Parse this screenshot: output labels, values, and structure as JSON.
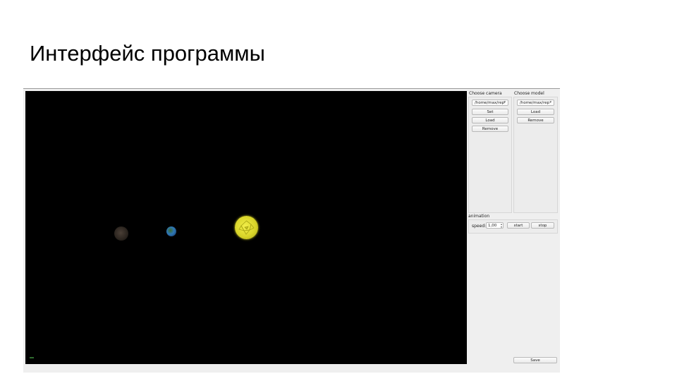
{
  "slide": {
    "title": "Интерфейс программы"
  },
  "panel": {
    "camera": {
      "title": "Choose camera",
      "selected": "/home/max/rep",
      "set_label": "Set",
      "load_label": "Load",
      "remove_label": "Remove"
    },
    "model": {
      "title": "Choose model",
      "selected": "/home/max/rep",
      "load_label": "Load",
      "remove_label": "Remove"
    },
    "animation": {
      "title": "animation",
      "speed_label": "speed:",
      "speed_value": "1,00",
      "start_label": "start",
      "stop_label": "stop"
    },
    "save_label": "Save"
  },
  "scene": {
    "background_color": "#000000",
    "objects": [
      "dark-planet",
      "earth-planet",
      "sun"
    ]
  },
  "colors": {
    "panel_bg": "#efefef",
    "sun": "#e6e23a"
  }
}
